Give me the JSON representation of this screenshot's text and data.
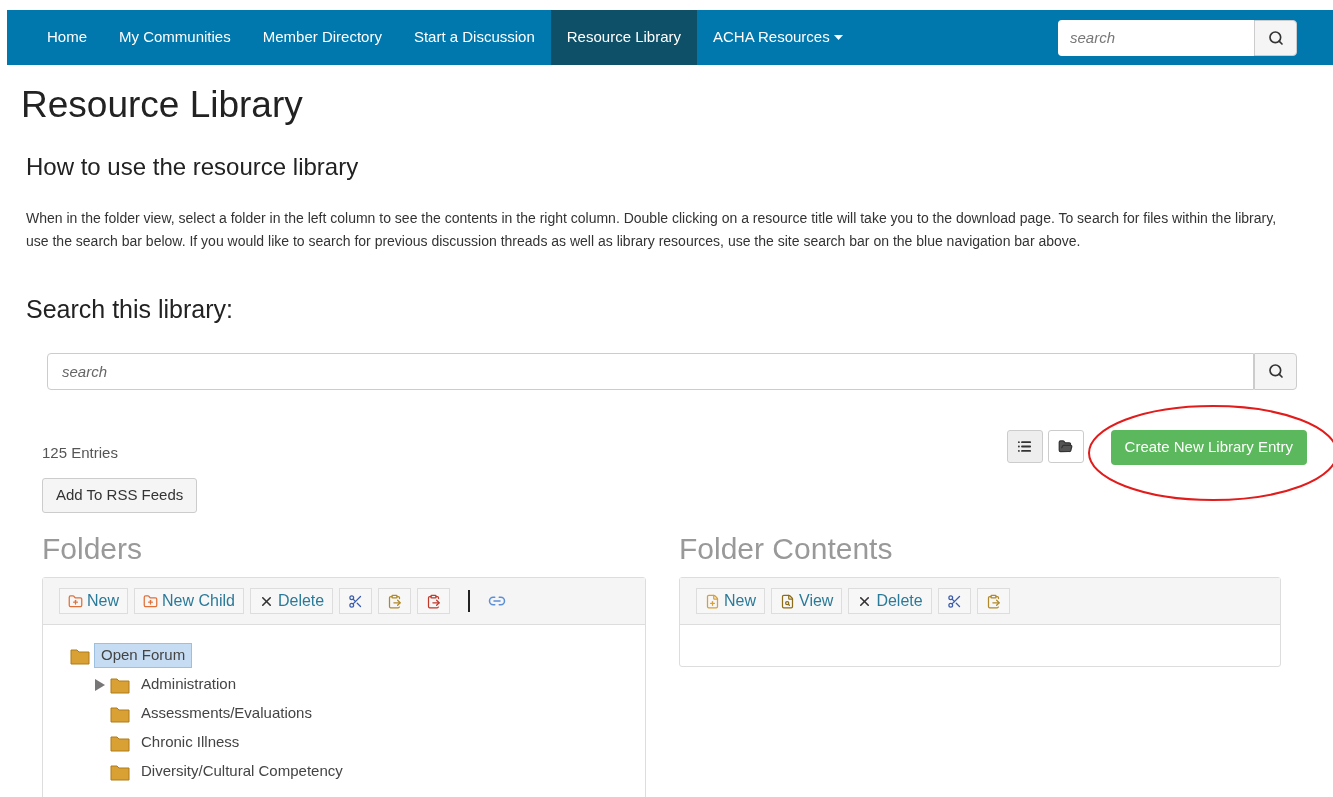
{
  "nav": {
    "items": [
      {
        "label": "Home",
        "selected": false,
        "dropdown": false
      },
      {
        "label": "My Communities",
        "selected": false,
        "dropdown": false
      },
      {
        "label": "Member Directory",
        "selected": false,
        "dropdown": false
      },
      {
        "label": "Start a Discussion",
        "selected": false,
        "dropdown": false
      },
      {
        "label": "Resource Library",
        "selected": true,
        "dropdown": false
      },
      {
        "label": "ACHA Resources",
        "selected": false,
        "dropdown": true
      }
    ],
    "search": {
      "placeholder": "search"
    }
  },
  "page_title": "Resource Library",
  "help": {
    "heading": "How to use the resource library",
    "text": "When in the folder view, select a folder in the left column to see the contents in the right column. Double clicking on a resource title will take you to the download page. To search for files within the library, use the search bar below. If you would like to search for previous discussion threads as well as library resources, use the site search bar on the blue navigation bar above."
  },
  "library_search": {
    "heading": "Search this library:",
    "placeholder": "search"
  },
  "entries_count": "125 Entries",
  "rss_button": "Add To RSS Feeds",
  "view_toggle": [
    {
      "kind": "list",
      "selected": true
    },
    {
      "kind": "folder",
      "selected": false
    }
  ],
  "create_button": {
    "label": "Create New Library Entry",
    "highlighted": true
  },
  "folders": {
    "heading": "Folders",
    "toolbar": [
      {
        "kind": "new",
        "label": "New"
      },
      {
        "kind": "new",
        "label": "New Child"
      },
      {
        "kind": "delete",
        "label": "Delete"
      },
      {
        "kind": "cut"
      },
      {
        "kind": "paste"
      },
      {
        "kind": "paste-delete"
      },
      {
        "kind": "separator"
      },
      {
        "kind": "link"
      }
    ],
    "tree": [
      {
        "label": "Open Forum",
        "selected": true,
        "kind": "root",
        "children": [
          {
            "label": "Administration",
            "selected": false,
            "kind": "collapsed"
          },
          {
            "label": "Assessments/Evaluations",
            "selected": false,
            "kind": "leaf"
          },
          {
            "label": "Chronic Illness",
            "selected": false,
            "kind": "leaf"
          },
          {
            "label": "Diversity/Cultural Competency",
            "selected": false,
            "kind": "leaf"
          }
        ]
      }
    ]
  },
  "contents": {
    "heading": "Folder Contents",
    "toolbar": [
      {
        "kind": "new-file",
        "label": "New"
      },
      {
        "kind": "view",
        "label": "View"
      },
      {
        "kind": "delete",
        "label": "Delete"
      },
      {
        "kind": "cut"
      },
      {
        "kind": "paste"
      }
    ]
  }
}
